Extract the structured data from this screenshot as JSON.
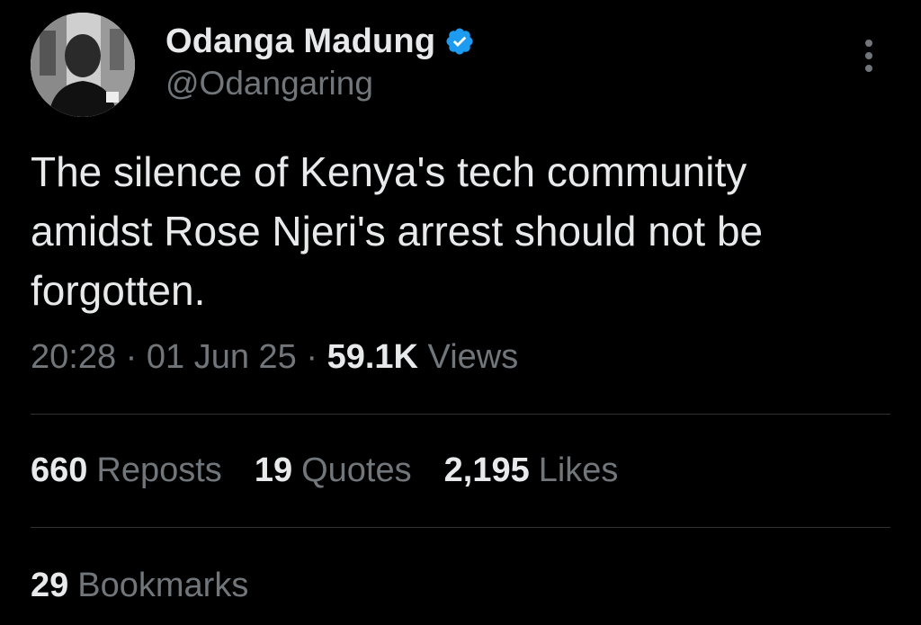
{
  "author": {
    "display_name": "Odanga Madung",
    "handle": "@Odangaring",
    "verified_color": "#1d9bf0",
    "avatar_icon": "profile-photo"
  },
  "tweet": {
    "text": "The silence of Kenya's tech community\namidst Rose Njeri's arrest should not be\nforgotten."
  },
  "meta": {
    "time": "20:28",
    "sep1": "·",
    "date": "01 Jun 25",
    "sep2": "·",
    "views_count": "59.1K",
    "views_label": "Views"
  },
  "stats": {
    "reposts_count": "660",
    "reposts_label": "Reposts",
    "quotes_count": "19",
    "quotes_label": "Quotes",
    "likes_count": "2,195",
    "likes_label": "Likes",
    "bookmarks_count": "29",
    "bookmarks_label": "Bookmarks"
  },
  "colors": {
    "background": "#000000",
    "primary_text": "#e7e9ea",
    "secondary_text": "#71767b",
    "divider": "#2f3336"
  }
}
